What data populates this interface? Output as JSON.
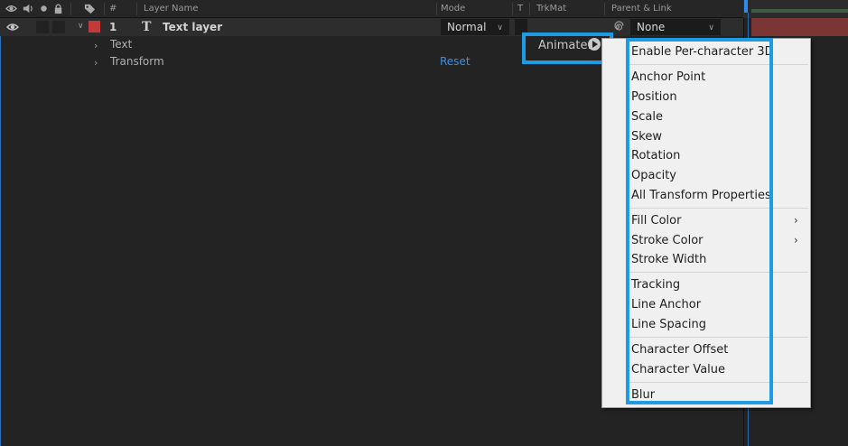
{
  "header": {
    "hash": "#",
    "layer_name": "Layer Name",
    "mode": "Mode",
    "t": "T",
    "trkmat": "TrkMat",
    "parent_link": "Parent & Link"
  },
  "layer": {
    "number": "1",
    "type_glyph": "T",
    "name": "Text layer",
    "label_color": "#c43a3a",
    "mode_value": "Normal",
    "parent_value": "None"
  },
  "properties": {
    "text": "Text",
    "transform": "Transform",
    "reset": "Reset"
  },
  "animate": {
    "label": "Animate:"
  },
  "menu": {
    "items": [
      "Enable Per-character 3D",
      "Anchor Point",
      "Position",
      "Scale",
      "Skew",
      "Rotation",
      "Opacity",
      "All Transform Properties",
      "Fill Color",
      "Stroke Color",
      "Stroke Width",
      "Tracking",
      "Line Anchor",
      "Line Spacing",
      "Character Offset",
      "Character Value",
      "Blur"
    ],
    "submenu_arrow": "›"
  },
  "colors": {
    "highlight": "#1e9be2",
    "link": "#3b8fe3"
  }
}
